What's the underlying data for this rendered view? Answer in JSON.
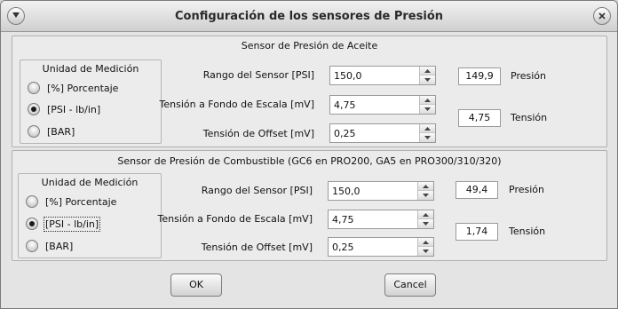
{
  "window": {
    "title": "Configuración de los sensores de Presión"
  },
  "oil": {
    "title": "Sensor de Presión de Aceite",
    "unit_title": "Unidad de Medición",
    "radios": [
      {
        "label": "[%] Porcentaje",
        "checked": false
      },
      {
        "label": "[PSI - lb/in]",
        "checked": true
      },
      {
        "label": "[BAR]",
        "checked": false
      }
    ],
    "range_label": "Rango del Sensor [PSI]",
    "range_value": "150,0",
    "fullscale_label": "Tensión a Fondo de Escala [mV]",
    "fullscale_value": "4,75",
    "offset_label": "Tensión de Offset [mV]",
    "offset_value": "0,25",
    "pressure_readout": "149,9",
    "pressure_label": "Presión",
    "voltage_readout": "4,75",
    "voltage_label": "Tensión"
  },
  "fuel": {
    "title": "Sensor de Presión de Combustible (GC6 en PRO200, GA5 en PRO300/310/320)",
    "unit_title": "Unidad de Medición",
    "radios": [
      {
        "label": "[%] Porcentaje",
        "checked": false
      },
      {
        "label": "[PSI - lb/in]",
        "checked": true
      },
      {
        "label": "[BAR]",
        "checked": false
      }
    ],
    "range_label": "Rango del Sensor [PSI]",
    "range_value": "150,0",
    "fullscale_label": "Tensión a Fondo de Escala [mV]",
    "fullscale_value": "4,75",
    "offset_label": "Tensión de Offset [mV]",
    "offset_value": "0,25",
    "pressure_readout": "49,4",
    "pressure_label": "Presión",
    "voltage_readout": "1,74",
    "voltage_label": "Tensión"
  },
  "buttons": {
    "ok": "OK",
    "cancel": "Cancel"
  }
}
